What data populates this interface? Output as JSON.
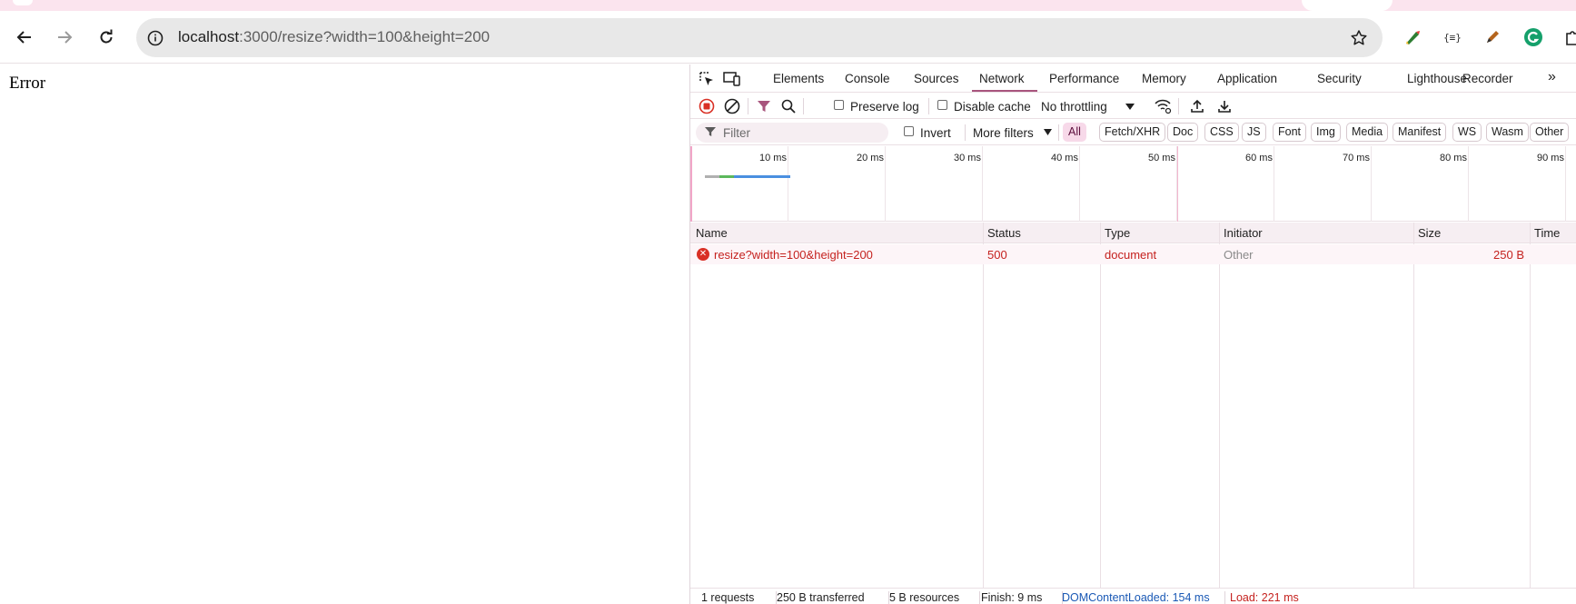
{
  "browser": {
    "url_host": "localhost",
    "url_rest": ":3000/resize?width=100&height=200",
    "icons": {
      "back": "back-arrow-icon",
      "forward": "forward-arrow-icon",
      "reload": "reload-icon",
      "site_info": "site-info-icon",
      "bookmark": "star-icon"
    },
    "extensions": [
      "colorful-extension-icon",
      "json-extension-icon",
      "pen-extension-icon",
      "grammarly-icon",
      "puzzle-extensions-icon"
    ],
    "extension_labels": {
      "json": "{≡}"
    }
  },
  "page": {
    "body_text": "Error"
  },
  "devtools": {
    "tabs": [
      "Elements",
      "Console",
      "Sources",
      "Network",
      "Performance",
      "Memory",
      "Application",
      "Security",
      "Lighthouse",
      "Recorder"
    ],
    "active_tab": "Network",
    "more_tabs": "»",
    "controls": {
      "preserve_log": "Preserve log",
      "disable_cache": "Disable cache",
      "throttling": "No throttling"
    },
    "filters": {
      "placeholder": "Filter",
      "invert": "Invert",
      "more_filters": "More filters",
      "types": [
        "All",
        "Fetch/XHR",
        "Doc",
        "CSS",
        "JS",
        "Font",
        "Img",
        "Media",
        "Manifest",
        "WS",
        "Wasm",
        "Other"
      ],
      "active_type": "All"
    },
    "timeline": {
      "labels": [
        "10 ms",
        "20 ms",
        "30 ms",
        "40 ms",
        "50 ms",
        "60 ms",
        "70 ms",
        "80 ms",
        "90 ms"
      ]
    },
    "table": {
      "columns": [
        "Name",
        "Status",
        "Type",
        "Initiator",
        "Size",
        "Time"
      ],
      "rows": [
        {
          "name": "resize?width=100&height=200",
          "status": "500",
          "type": "document",
          "initiator": "Other",
          "size": "250 B",
          "time": ""
        }
      ]
    },
    "summary": {
      "requests": "1 requests",
      "transferred": "250 B transferred",
      "resources": "5 B resources",
      "finish": "Finish: 9 ms",
      "dom_content_loaded": "DOMContentLoaded: 154 ms",
      "load": "Load: 221 ms"
    },
    "colors": {
      "accent": "#a8557d",
      "error": "#c5221f",
      "dcl_blue": "#1a59b5",
      "row_highlight": "#fdf5f8"
    }
  }
}
